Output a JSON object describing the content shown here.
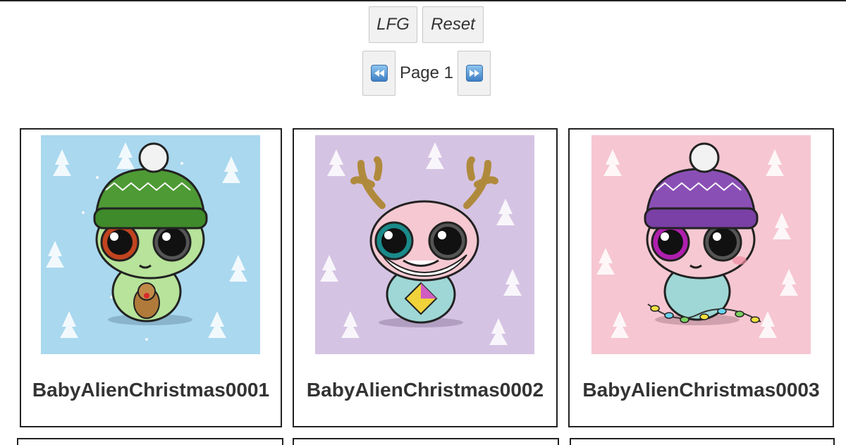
{
  "toolbar": {
    "lfg_label": "LFG",
    "reset_label": "Reset"
  },
  "pagination": {
    "prev_icon": "rewind-icon",
    "next_icon": "fast-forward-icon",
    "page_label": "Page 1"
  },
  "cards": [
    {
      "title": "BabyAlienChristmas0001",
      "background_color": "#a9d8ef",
      "hat_color": "#4e9a35",
      "skin_color": "#b7e39a",
      "eye_color": "#c0441f",
      "accessory": "reindeer-plush"
    },
    {
      "title": "BabyAlienChristmas0002",
      "background_color": "#d5c3e3",
      "hat": "antlers",
      "skin_color": "#f6c9d2",
      "eye_color": "#1a8a8a",
      "accessory": "kite"
    },
    {
      "title": "BabyAlienChristmas0003",
      "background_color": "#f6c6d2",
      "hat_color": "#8a4fb5",
      "skin_color": "#f6c9d2",
      "eye_color": "#b01fae",
      "accessory": "christmas-lights"
    }
  ]
}
